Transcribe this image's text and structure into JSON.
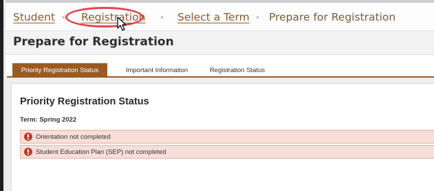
{
  "breadcrumb": {
    "items": [
      {
        "label": "Student"
      },
      {
        "label": "Registration"
      },
      {
        "label": "Select a Term"
      }
    ],
    "separator": "•",
    "current": "Prepare for Registration"
  },
  "page": {
    "title": "Prepare for Registration"
  },
  "tabs": [
    {
      "label": "Priority Registration Status",
      "active": true
    },
    {
      "label": "Important Information",
      "active": false
    },
    {
      "label": "Registration Status",
      "active": false
    }
  ],
  "panel": {
    "heading": "Priority Registration Status",
    "term": "Term: Spring 2022",
    "alerts": [
      {
        "icon": "exclamation-circle-icon",
        "text": "Orientation not completed"
      },
      {
        "icon": "exclamation-circle-icon",
        "text": "Student Education Plan (SEP) not completed"
      }
    ]
  },
  "colors": {
    "link": "#8a5a2b",
    "tab_active": "#9a5b22",
    "alert_bg": "#f7ded8",
    "alert_icon": "#c0392b",
    "annotation_ring": "#e0464f"
  }
}
